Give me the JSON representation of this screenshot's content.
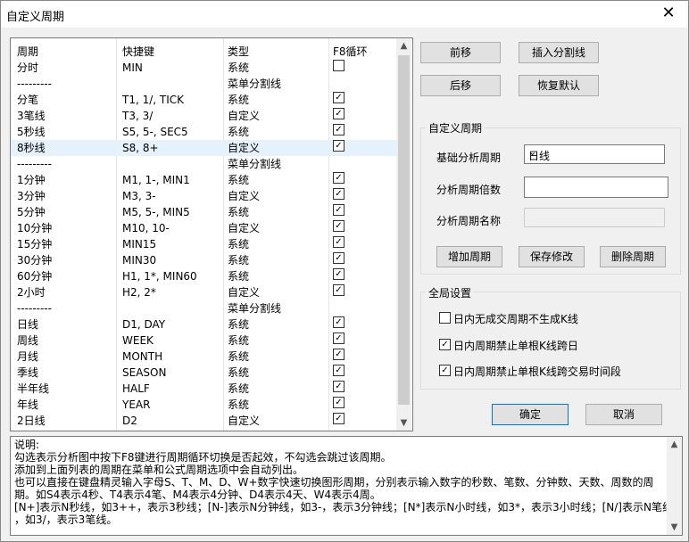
{
  "window": {
    "title": "自定义周期",
    "close": "✕"
  },
  "columns": [
    "周期",
    "快捷键",
    "类型",
    "F8循环"
  ],
  "rows": [
    {
      "period": "分时",
      "shortcut": "MIN",
      "type": "系统",
      "f8": "unchecked"
    },
    {
      "period": "---------",
      "shortcut": "",
      "type": "菜单分割线",
      "f8": "none"
    },
    {
      "period": "分笔",
      "shortcut": "T1, 1/, TICK",
      "type": "系统",
      "f8": "checked"
    },
    {
      "period": "3笔线",
      "shortcut": "T3, 3/",
      "type": "自定义",
      "f8": "checked"
    },
    {
      "period": "5秒线",
      "shortcut": "S5, 5-, SEC5",
      "type": "系统",
      "f8": "checked"
    },
    {
      "period": "8秒线",
      "shortcut": "S8, 8+",
      "type": "自定义",
      "f8": "checked",
      "selected": true
    },
    {
      "period": "---------",
      "shortcut": "",
      "type": "菜单分割线",
      "f8": "none"
    },
    {
      "period": "1分钟",
      "shortcut": "M1, 1-, MIN1",
      "type": "系统",
      "f8": "checked"
    },
    {
      "period": "3分钟",
      "shortcut": "M3, 3-",
      "type": "自定义",
      "f8": "checked"
    },
    {
      "period": "5分钟",
      "shortcut": "M5, 5-, MIN5",
      "type": "系统",
      "f8": "checked"
    },
    {
      "period": "10分钟",
      "shortcut": "M10, 10-",
      "type": "自定义",
      "f8": "checked"
    },
    {
      "period": "15分钟",
      "shortcut": "MIN15",
      "type": "系统",
      "f8": "checked"
    },
    {
      "period": "30分钟",
      "shortcut": "MIN30",
      "type": "系统",
      "f8": "checked"
    },
    {
      "period": "60分钟",
      "shortcut": "H1, 1*, MIN60",
      "type": "系统",
      "f8": "checked"
    },
    {
      "period": "2小时",
      "shortcut": "H2, 2*",
      "type": "自定义",
      "f8": "checked"
    },
    {
      "period": "---------",
      "shortcut": "",
      "type": "菜单分割线",
      "f8": "none"
    },
    {
      "period": "日线",
      "shortcut": "D1, DAY",
      "type": "系统",
      "f8": "checked"
    },
    {
      "period": "周线",
      "shortcut": "WEEK",
      "type": "系统",
      "f8": "checked"
    },
    {
      "period": "月线",
      "shortcut": "MONTH",
      "type": "系统",
      "f8": "checked"
    },
    {
      "period": "季线",
      "shortcut": "SEASON",
      "type": "系统",
      "f8": "checked"
    },
    {
      "period": "半年线",
      "shortcut": "HALF",
      "type": "系统",
      "f8": "checked"
    },
    {
      "period": "年线",
      "shortcut": "YEAR",
      "type": "系统",
      "f8": "checked"
    },
    {
      "period": "2日线",
      "shortcut": "D2",
      "type": "自定义",
      "f8": "checked"
    }
  ],
  "buttons": {
    "move_up": "前移",
    "insert_sep": "插入分割线",
    "move_down": "后移",
    "restore": "恢复默认",
    "add": "增加周期",
    "save": "保存修改",
    "delete": "删除周期",
    "ok": "确定",
    "cancel": "取消"
  },
  "custom_group": {
    "title": "自定义周期",
    "base_label": "基础分析周期",
    "base_value": "日线",
    "multiple_label": "分析周期倍数",
    "multiple_value": "",
    "name_label": "分析周期名称",
    "name_value": ""
  },
  "global_group": {
    "title": "全局设置",
    "options": [
      {
        "label": "日内无成交周期不生成K线",
        "checked": false
      },
      {
        "label": "日内周期禁止单根K线跨日",
        "checked": true
      },
      {
        "label": "日内周期禁止单根K线跨交易时间段",
        "checked": true
      }
    ]
  },
  "description": [
    "说明:",
    "勾选表示分析图中按下F8键进行周期循环切换是否起效，不勾选会跳过该周期。",
    "添加到上面列表的周期在菜单和公式周期选项中会自动列出。",
    "也可以直接在键盘精灵输入字母S、T、M、D、W+数字快速切换图形周期，分别表示输入数字的秒数、笔数、分钟数、天数、周数的周",
    "期。如S4表示4秒、T4表示4笔、M4表示4分钟、D4表示4天、W4表示4周。",
    "[N+]表示N秒线，如3++，表示3秒线；[N-]表示N分钟线，如3-，表示3分钟线；[N*]表示N小时线，如3*，表示3小时线；[N/]表示N笔线",
    "，如3/，表示3笔线。"
  ],
  "icons": {
    "check": "✓",
    "scroll_up": "▲",
    "scroll_down": "▼",
    "dropdown": "⌄"
  }
}
